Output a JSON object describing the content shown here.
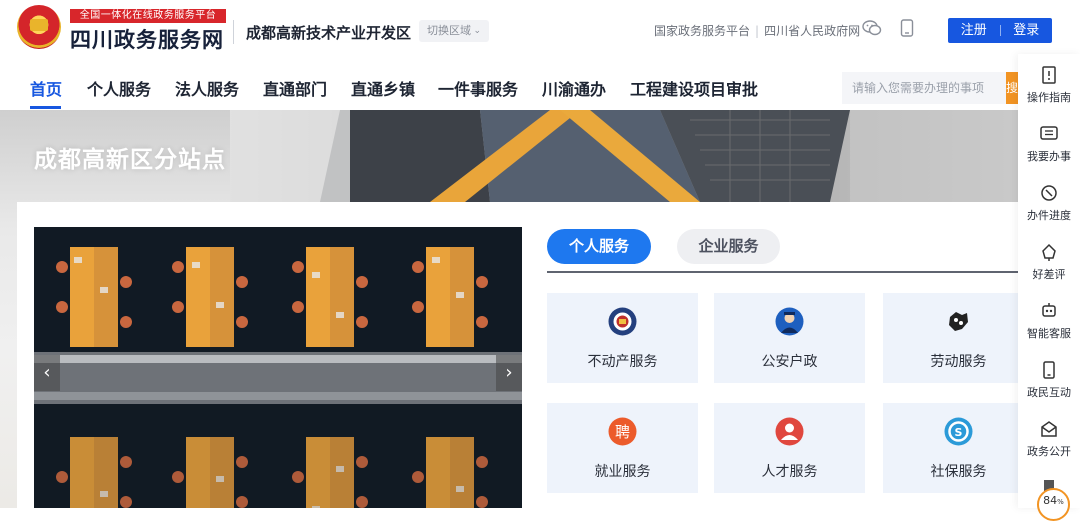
{
  "header": {
    "slogan": "全国一体化在线政务服务平台",
    "site_title": "四川政务服务网",
    "region_name": "成都高新技术产业开发区",
    "region_switch": "切换区域",
    "links": [
      "国家政务服务平台",
      "四川省人民政府网"
    ],
    "register": "注册",
    "login": "登录"
  },
  "nav": {
    "items": [
      "首页",
      "个人服务",
      "法人服务",
      "直通部门",
      "直通乡镇",
      "一件事服务",
      "川渝通办",
      "工程建设项目审批"
    ],
    "search_placeholder": "请输入您需要办理的事项",
    "search_button": "搜索"
  },
  "banner": {
    "title": "成都高新区分站点"
  },
  "services": {
    "tabs": [
      "个人服务",
      "企业服务"
    ],
    "tiles": [
      {
        "label": "不动产服务",
        "icon": "real-estate-icon"
      },
      {
        "label": "公安户政",
        "icon": "police-icon"
      },
      {
        "label": "劳动服务",
        "icon": "labor-icon"
      },
      {
        "label": "就业服务",
        "icon": "employment-icon"
      },
      {
        "label": "人才服务",
        "icon": "talent-icon"
      },
      {
        "label": "社保服务",
        "icon": "social-security-icon"
      }
    ]
  },
  "rail": {
    "items": [
      "操作指南",
      "我要办事",
      "办件进度",
      "好差评",
      "智能客服",
      "政民互动",
      "政务公开"
    ]
  },
  "badge": {
    "value": "84",
    "unit": "%"
  },
  "colors": {
    "primary": "#1757e0",
    "tab_blue": "#1e78ef",
    "orange": "#f29423",
    "slogan_red": "#d8262b"
  }
}
